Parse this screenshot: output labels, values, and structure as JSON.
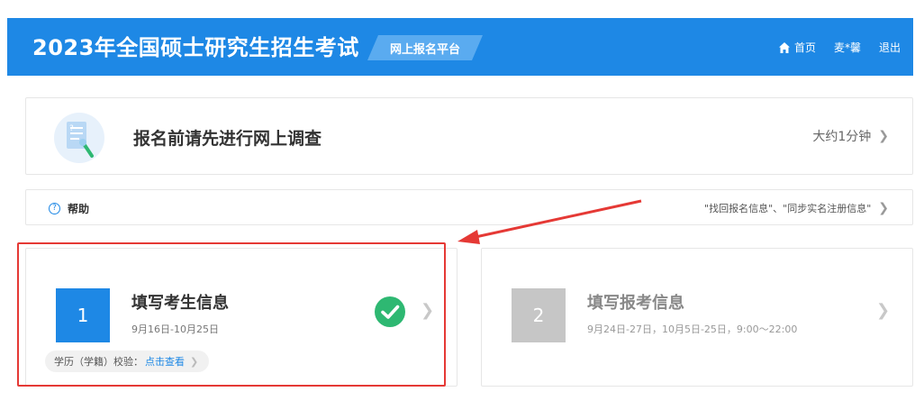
{
  "header": {
    "title": "2023年全国硕士研究生招生考试",
    "platform": "网上报名平台",
    "nav": {
      "home": "首页",
      "user": "麦*馨",
      "logout": "退出"
    }
  },
  "survey": {
    "title": "报名前请先进行网上调查",
    "time": "大约1分钟"
  },
  "help": {
    "label": "帮助",
    "links": "\"找回报名信息\"、\"同步实名注册信息\""
  },
  "steps": [
    {
      "number": "1",
      "title": "填写考生信息",
      "date": "9月16日-10月25日",
      "verify_label": "学历（学籍）校验：",
      "verify_link": "点击查看",
      "completed": true
    },
    {
      "number": "2",
      "title": "填写报考信息",
      "date": "9月24日-27日，10月5日-25日，9:00～22:00",
      "completed": false
    }
  ],
  "colors": {
    "primary": "#1e88e5",
    "success": "#2eb872",
    "annotation": "#e53935",
    "disabled": "#c6c6c6"
  }
}
